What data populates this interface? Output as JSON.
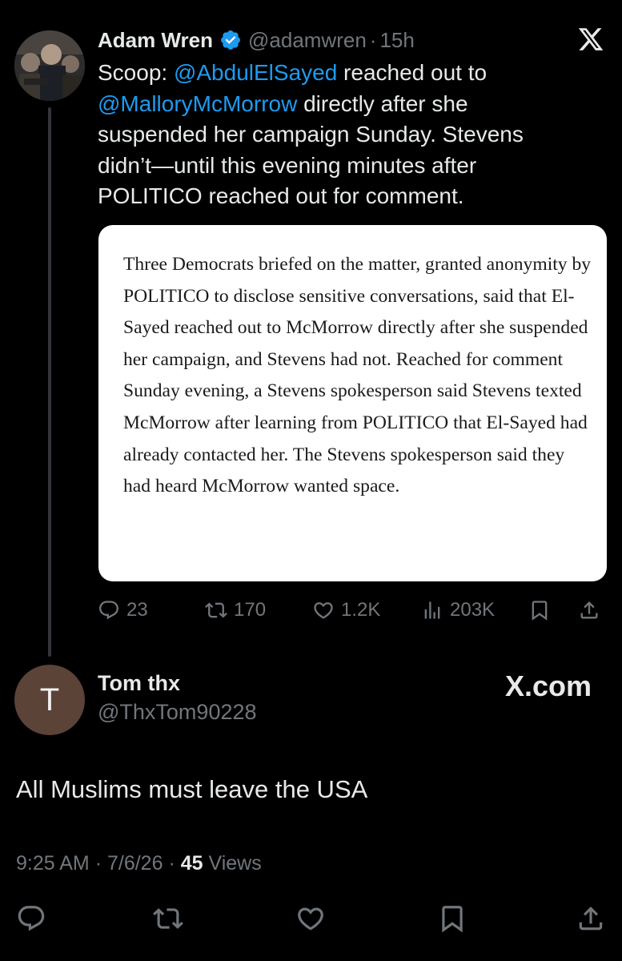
{
  "original_tweet": {
    "author_name": "Adam Wren",
    "handle": "@adamwren",
    "separator": "·",
    "age": "15h",
    "text_parts": [
      {
        "t": "Scoop: ",
        "m": false
      },
      {
        "t": "@AbdulElSayed",
        "m": true
      },
      {
        "t": " reached out to ",
        "m": false
      },
      {
        "t": "@MalloryMcMorrow",
        "m": true
      },
      {
        "t": " directly after she suspended her campaign Sunday. Stevens didn’t—until this evening minutes after POLITICO reached out for comment.",
        "m": false
      }
    ],
    "quote_text": "Three Democrats briefed on the matter, granted anonymity by POLITICO to disclose sensitive conversations, said that El-Sayed reached out to McMorrow directly after she suspended her campaign, and Stevens had not. Reached for comment Sunday evening, a Stevens spokesperson said Stevens texted McMorrow after learning from POLITICO that El-Sayed had already contacted her. The Stevens spokesperson said they had heard McMorrow wanted space.",
    "stats": {
      "replies": "23",
      "reposts": "170",
      "likes": "1.2K",
      "views": "203K"
    }
  },
  "reply": {
    "avatar_letter": "T",
    "author_name": "Tom thx",
    "handle": "@ThxTom90228",
    "watermark": "X.com",
    "text": "All Muslims must leave the USA",
    "time": "9:25 AM",
    "date": "7/6/26",
    "separator": "·",
    "views_count": "45",
    "views_label": "Views"
  },
  "colors": {
    "background": "#000000",
    "text": "#e7e9ea",
    "muted": "#71767b",
    "accent": "#1d9bf0",
    "reply_avatar": "#5b4338"
  },
  "icons": [
    "verified-badge-icon",
    "x-logo-icon",
    "reply-icon",
    "repost-icon",
    "like-icon",
    "views-icon",
    "bookmark-icon",
    "share-icon"
  ]
}
